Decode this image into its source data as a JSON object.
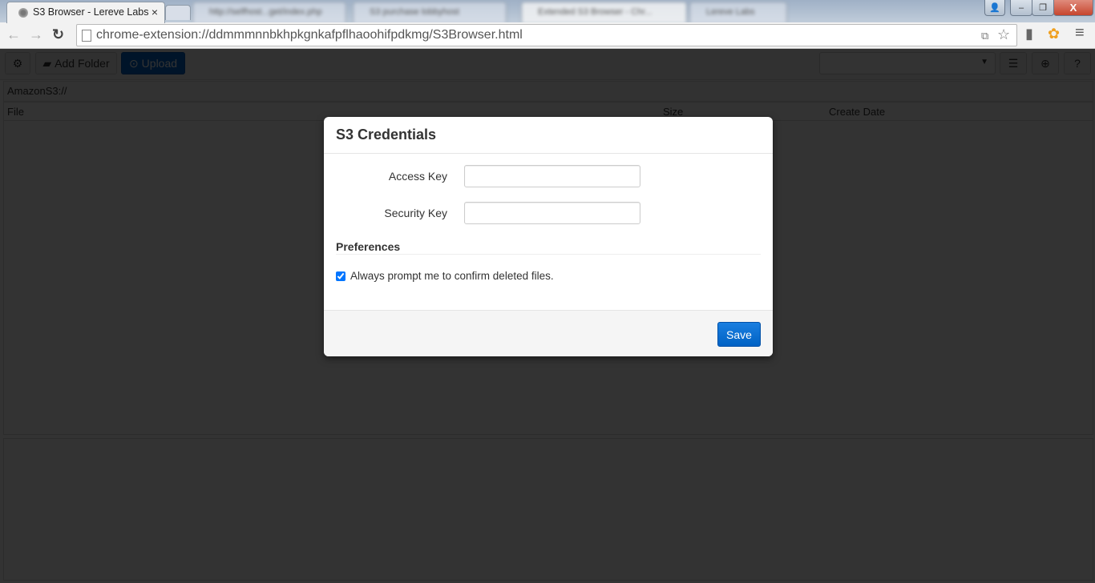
{
  "browser": {
    "active_tab": {
      "title": "S3 Browser - Lereve Labs",
      "close_glyph": "×"
    },
    "background_tabs": [
      "http://selfhost...get/index.php",
      "S3 purchase lobbyhost",
      "Extended S3 Browser - Chr...",
      "Lereve Labs"
    ],
    "window_controls": {
      "user": "👤",
      "minimize": "–",
      "maximize": "❐",
      "close": "X"
    },
    "nav": {
      "back": "←",
      "forward": "→",
      "reload": "↻"
    },
    "url": "chrome-extension://ddmmmnnbkhpkgnkafpflhaoohifpdkmg/S3Browser.html",
    "omnibox_icons": {
      "translate": "⧉",
      "bookmark": "☆"
    },
    "extension_icons": {
      "cast": "▮",
      "aws": "✿",
      "menu": "≡"
    }
  },
  "app": {
    "toolbar": {
      "settings_icon": "⚙",
      "add_folder_icon": "▰",
      "add_folder_label": "Add Folder",
      "upload_icon": "⊙",
      "upload_label": "Upload",
      "bucket_select_value": "",
      "bucket_select_arrow": "▼",
      "list_icon": "☰",
      "add_icon": "⊕",
      "help_icon": "?"
    },
    "path": "AmazonS3://",
    "file_table": {
      "columns": [
        "File",
        "Size",
        "Create Date"
      ],
      "rows": []
    }
  },
  "modal": {
    "title": "S3 Credentials",
    "fields": [
      {
        "label": "Access Key",
        "value": "",
        "placeholder": ""
      },
      {
        "label": "Security Key",
        "value": "",
        "placeholder": ""
      }
    ],
    "preferences_title": "Preferences",
    "confirm_delete": {
      "label": "Always prompt me to confirm deleted files.",
      "checked": true
    },
    "save_label": "Save"
  }
}
